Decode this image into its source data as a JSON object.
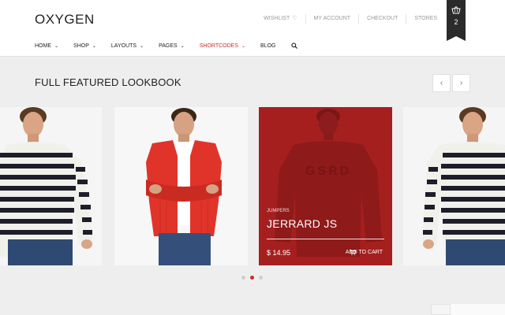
{
  "header": {
    "logo": "OXYGEN",
    "top_links": [
      "WISHLIST",
      "MY ACCOUNT",
      "CHECKOUT",
      "STORES"
    ],
    "cart_count": "2"
  },
  "nav": {
    "items": [
      {
        "label": "HOME",
        "has_dropdown": true
      },
      {
        "label": "SHOP",
        "has_dropdown": true
      },
      {
        "label": "LAYOUTS",
        "has_dropdown": true
      },
      {
        "label": "PAGES",
        "has_dropdown": true
      },
      {
        "label": "SHORTCODES",
        "has_dropdown": true,
        "active": true
      },
      {
        "label": "BLOG",
        "has_dropdown": false
      }
    ]
  },
  "lookbook": {
    "title": "FULL FEATURED LOOKBOOK",
    "featured": {
      "category": "JUMPERS",
      "name": "JERRARD JS",
      "price": "$ 14.95",
      "add_to_cart": "ADD TO CART",
      "sweater_print": "GSRD"
    },
    "pagination": {
      "count": 3,
      "active": 1
    }
  },
  "colors": {
    "accent": "#cf2b2b",
    "overlay": "#a51f1f",
    "dark": "#2b2b2b"
  }
}
